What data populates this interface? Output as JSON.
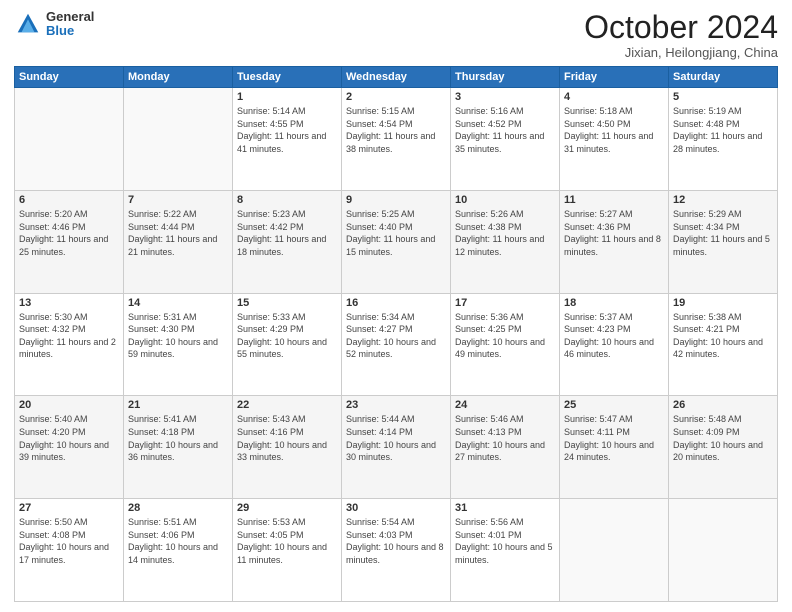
{
  "header": {
    "logo_general": "General",
    "logo_blue": "Blue",
    "month": "October 2024",
    "location": "Jixian, Heilongjiang, China"
  },
  "weekdays": [
    "Sunday",
    "Monday",
    "Tuesday",
    "Wednesday",
    "Thursday",
    "Friday",
    "Saturday"
  ],
  "weeks": [
    [
      {
        "day": "",
        "info": ""
      },
      {
        "day": "",
        "info": ""
      },
      {
        "day": "1",
        "info": "Sunrise: 5:14 AM\nSunset: 4:55 PM\nDaylight: 11 hours and 41 minutes."
      },
      {
        "day": "2",
        "info": "Sunrise: 5:15 AM\nSunset: 4:54 PM\nDaylight: 11 hours and 38 minutes."
      },
      {
        "day": "3",
        "info": "Sunrise: 5:16 AM\nSunset: 4:52 PM\nDaylight: 11 hours and 35 minutes."
      },
      {
        "day": "4",
        "info": "Sunrise: 5:18 AM\nSunset: 4:50 PM\nDaylight: 11 hours and 31 minutes."
      },
      {
        "day": "5",
        "info": "Sunrise: 5:19 AM\nSunset: 4:48 PM\nDaylight: 11 hours and 28 minutes."
      }
    ],
    [
      {
        "day": "6",
        "info": "Sunrise: 5:20 AM\nSunset: 4:46 PM\nDaylight: 11 hours and 25 minutes."
      },
      {
        "day": "7",
        "info": "Sunrise: 5:22 AM\nSunset: 4:44 PM\nDaylight: 11 hours and 21 minutes."
      },
      {
        "day": "8",
        "info": "Sunrise: 5:23 AM\nSunset: 4:42 PM\nDaylight: 11 hours and 18 minutes."
      },
      {
        "day": "9",
        "info": "Sunrise: 5:25 AM\nSunset: 4:40 PM\nDaylight: 11 hours and 15 minutes."
      },
      {
        "day": "10",
        "info": "Sunrise: 5:26 AM\nSunset: 4:38 PM\nDaylight: 11 hours and 12 minutes."
      },
      {
        "day": "11",
        "info": "Sunrise: 5:27 AM\nSunset: 4:36 PM\nDaylight: 11 hours and 8 minutes."
      },
      {
        "day": "12",
        "info": "Sunrise: 5:29 AM\nSunset: 4:34 PM\nDaylight: 11 hours and 5 minutes."
      }
    ],
    [
      {
        "day": "13",
        "info": "Sunrise: 5:30 AM\nSunset: 4:32 PM\nDaylight: 11 hours and 2 minutes."
      },
      {
        "day": "14",
        "info": "Sunrise: 5:31 AM\nSunset: 4:30 PM\nDaylight: 10 hours and 59 minutes."
      },
      {
        "day": "15",
        "info": "Sunrise: 5:33 AM\nSunset: 4:29 PM\nDaylight: 10 hours and 55 minutes."
      },
      {
        "day": "16",
        "info": "Sunrise: 5:34 AM\nSunset: 4:27 PM\nDaylight: 10 hours and 52 minutes."
      },
      {
        "day": "17",
        "info": "Sunrise: 5:36 AM\nSunset: 4:25 PM\nDaylight: 10 hours and 49 minutes."
      },
      {
        "day": "18",
        "info": "Sunrise: 5:37 AM\nSunset: 4:23 PM\nDaylight: 10 hours and 46 minutes."
      },
      {
        "day": "19",
        "info": "Sunrise: 5:38 AM\nSunset: 4:21 PM\nDaylight: 10 hours and 42 minutes."
      }
    ],
    [
      {
        "day": "20",
        "info": "Sunrise: 5:40 AM\nSunset: 4:20 PM\nDaylight: 10 hours and 39 minutes."
      },
      {
        "day": "21",
        "info": "Sunrise: 5:41 AM\nSunset: 4:18 PM\nDaylight: 10 hours and 36 minutes."
      },
      {
        "day": "22",
        "info": "Sunrise: 5:43 AM\nSunset: 4:16 PM\nDaylight: 10 hours and 33 minutes."
      },
      {
        "day": "23",
        "info": "Sunrise: 5:44 AM\nSunset: 4:14 PM\nDaylight: 10 hours and 30 minutes."
      },
      {
        "day": "24",
        "info": "Sunrise: 5:46 AM\nSunset: 4:13 PM\nDaylight: 10 hours and 27 minutes."
      },
      {
        "day": "25",
        "info": "Sunrise: 5:47 AM\nSunset: 4:11 PM\nDaylight: 10 hours and 24 minutes."
      },
      {
        "day": "26",
        "info": "Sunrise: 5:48 AM\nSunset: 4:09 PM\nDaylight: 10 hours and 20 minutes."
      }
    ],
    [
      {
        "day": "27",
        "info": "Sunrise: 5:50 AM\nSunset: 4:08 PM\nDaylight: 10 hours and 17 minutes."
      },
      {
        "day": "28",
        "info": "Sunrise: 5:51 AM\nSunset: 4:06 PM\nDaylight: 10 hours and 14 minutes."
      },
      {
        "day": "29",
        "info": "Sunrise: 5:53 AM\nSunset: 4:05 PM\nDaylight: 10 hours and 11 minutes."
      },
      {
        "day": "30",
        "info": "Sunrise: 5:54 AM\nSunset: 4:03 PM\nDaylight: 10 hours and 8 minutes."
      },
      {
        "day": "31",
        "info": "Sunrise: 5:56 AM\nSunset: 4:01 PM\nDaylight: 10 hours and 5 minutes."
      },
      {
        "day": "",
        "info": ""
      },
      {
        "day": "",
        "info": ""
      }
    ]
  ]
}
